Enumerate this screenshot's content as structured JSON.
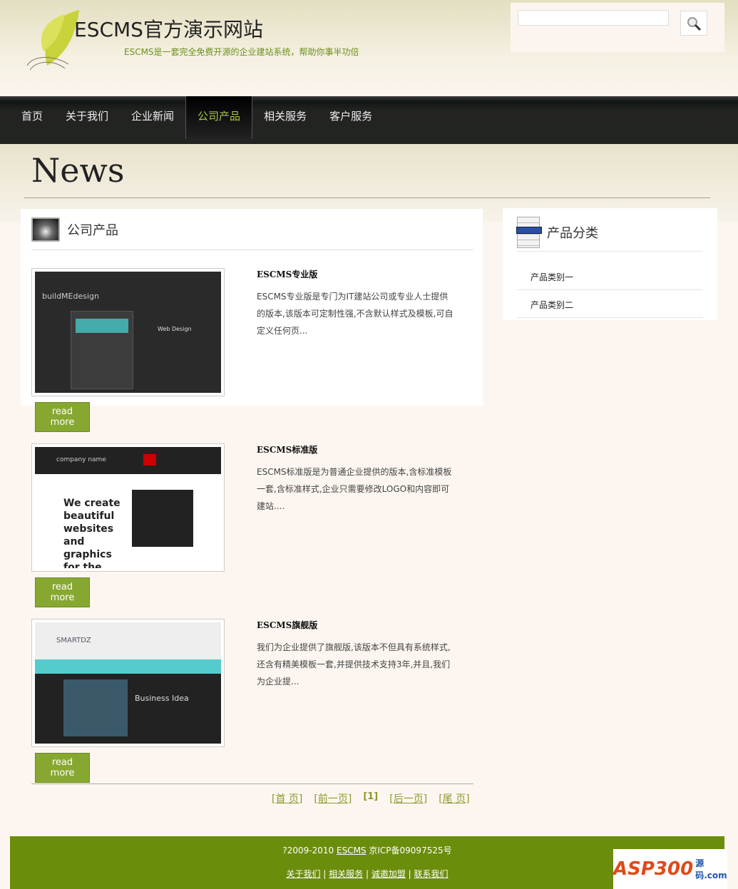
{
  "header": {
    "title": "ESCMS官方演示网站",
    "subtitle": "ESCMS是一套完全免费开源的企业建站系统，帮助你事半功倍",
    "search_placeholder": ""
  },
  "nav": [
    "首页",
    "关于我们",
    "企业新闻",
    "公司产品",
    "相关服务",
    "客户服务"
  ],
  "page_title": "News",
  "main": {
    "heading": "公司产品",
    "read_more": "read more",
    "items": [
      {
        "title": "ESCMS专业版",
        "desc": "ESCMS专业版是专门为IT建站公司或专业人士提供的版本,该版本可定制性强,不含默认样式及模板,可自定义任何页...",
        "thumb_text": "buildMEdesign",
        "thumb_sub": "Web Design"
      },
      {
        "title": "ESCMS标准版",
        "desc": "ESCMS标准版是为普通企业提供的版本,含标准模板一套,含标准样式,企业只需要修改LOGO和内容即可建站....",
        "thumb_text": "We create beautiful websites and graphics for the web!",
        "thumb_sub": "company name"
      },
      {
        "title": "ESCMS旗舰版",
        "desc": "我们为企业提供了旗舰版,该版本不但具有系统样式,还含有精美模板一套,并提供技术支持3年,并且,我们为企业提...",
        "thumb_text": "Business Idea",
        "thumb_sub": "SMARTDZ"
      }
    ]
  },
  "pager": {
    "first": "[首 页]",
    "prev": "[前一页]",
    "current": "[1]",
    "next": "[后一页]",
    "last": "[尾 页]"
  },
  "sidebar": {
    "heading": "产品分类",
    "items": [
      "产品类别一",
      "产品类别二"
    ]
  },
  "footer": {
    "copy_pre": "?2009-2010",
    "copy_link": "ESCMS",
    "copy_post": "京ICP备09097525号",
    "links": [
      "关于我们",
      "相关服务",
      "诚邀加盟",
      "联系我们"
    ]
  },
  "badge": {
    "text": "ASP300",
    "sub": "源码.com"
  }
}
